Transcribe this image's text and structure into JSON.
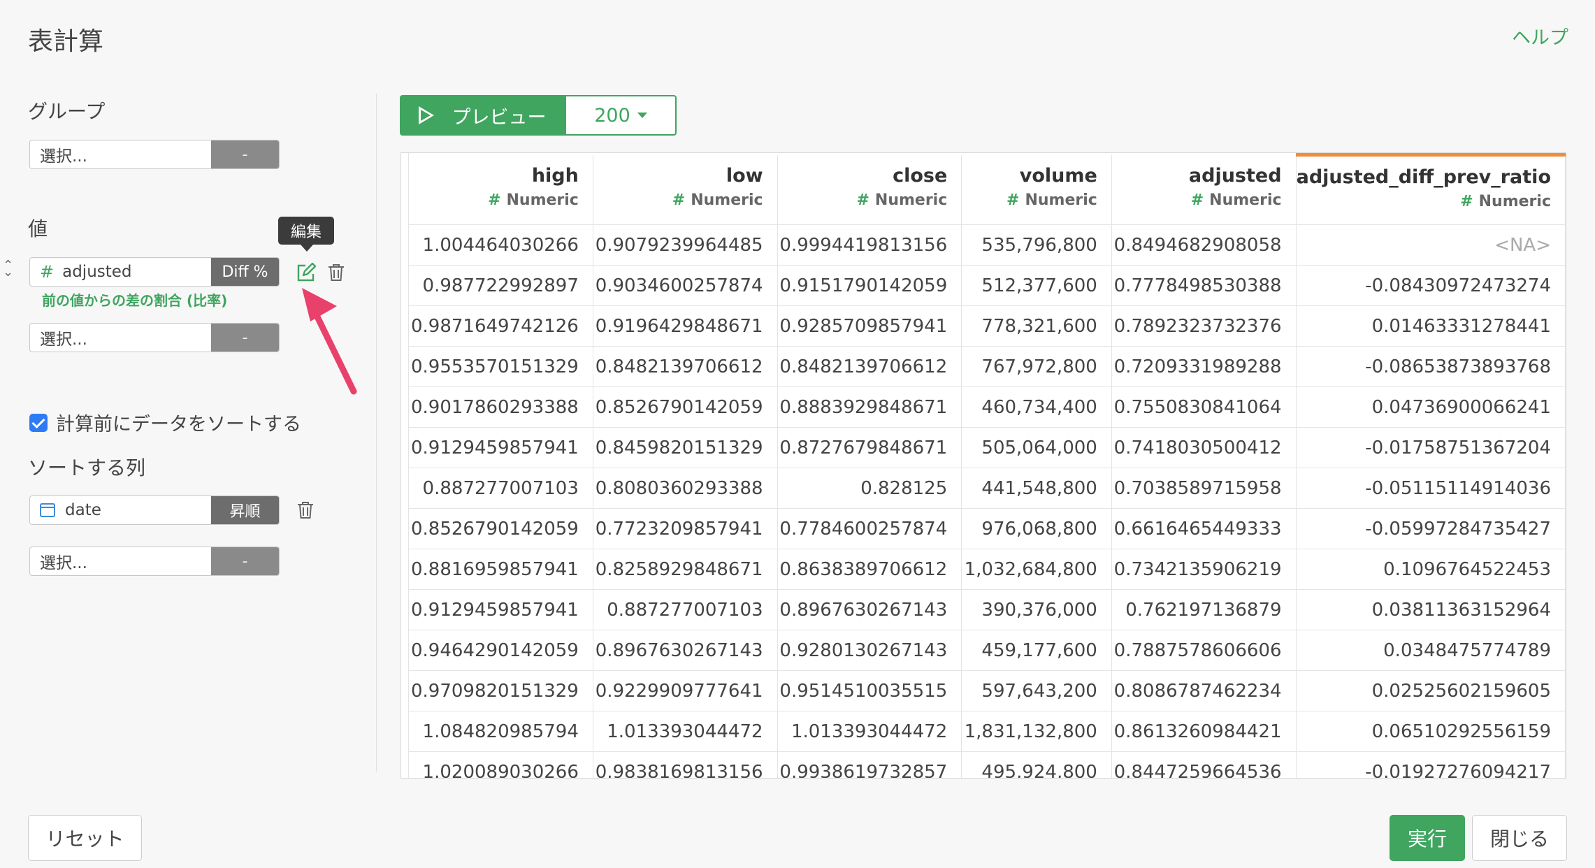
{
  "dialog": {
    "title": "表計算",
    "help": "ヘルプ"
  },
  "group": {
    "label": "グループ",
    "select_placeholder": "選択...",
    "select_btn": "-"
  },
  "values": {
    "label": "値",
    "item": {
      "type_icon": "#",
      "name": "adjusted",
      "calc": "Diff %",
      "description": "前の値からの差の割合 (比率)"
    },
    "edit_tooltip": "編集",
    "select_placeholder": "選択...",
    "select_btn": "-"
  },
  "sort": {
    "checkbox_label": "計算前にデータをソートする",
    "checked": true,
    "columns_label": "ソートする列",
    "item": {
      "name": "date",
      "order": "昇順"
    },
    "select_placeholder": "選択...",
    "select_btn": "-"
  },
  "preview": {
    "label": "プレビュー",
    "count": "200"
  },
  "table": {
    "columns": [
      {
        "name": "high",
        "type": "Numeric"
      },
      {
        "name": "low",
        "type": "Numeric"
      },
      {
        "name": "close",
        "type": "Numeric"
      },
      {
        "name": "volume",
        "type": "Numeric"
      },
      {
        "name": "adjusted",
        "type": "Numeric"
      },
      {
        "name": "adjusted_diff_prev_ratio",
        "type": "Numeric"
      }
    ],
    "type_icon": "#",
    "rows": [
      [
        "1.004464030266",
        "0.9079239964485",
        "0.9994419813156",
        "535,796,800",
        "0.8494682908058",
        "<NA>"
      ],
      [
        "0.987722992897",
        "0.9034600257874",
        "0.9151790142059",
        "512,377,600",
        "0.7778498530388",
        "-0.08430972473274"
      ],
      [
        "0.9871649742126",
        "0.9196429848671",
        "0.9285709857941",
        "778,321,600",
        "0.7892323732376",
        "0.01463331278441"
      ],
      [
        "0.9553570151329",
        "0.8482139706612",
        "0.8482139706612",
        "767,972,800",
        "0.7209331989288",
        "-0.08653873893768"
      ],
      [
        "0.9017860293388",
        "0.8526790142059",
        "0.8883929848671",
        "460,734,400",
        "0.7550830841064",
        "0.04736900066241"
      ],
      [
        "0.9129459857941",
        "0.8459820151329",
        "0.8727679848671",
        "505,064,000",
        "0.7418030500412",
        "-0.01758751367204"
      ],
      [
        "0.887277007103",
        "0.8080360293388",
        "0.828125",
        "441,548,800",
        "0.7038589715958",
        "-0.05115114914036"
      ],
      [
        "0.8526790142059",
        "0.7723209857941",
        "0.7784600257874",
        "976,068,800",
        "0.6616465449333",
        "-0.05997284735427"
      ],
      [
        "0.8816959857941",
        "0.8258929848671",
        "0.8638389706612",
        "1,032,684,800",
        "0.7342135906219",
        "0.1096764522453"
      ],
      [
        "0.9129459857941",
        "0.887277007103",
        "0.8967630267143",
        "390,376,000",
        "0.762197136879",
        "0.03811363152964"
      ],
      [
        "0.9464290142059",
        "0.8967630267143",
        "0.9280130267143",
        "459,177,600",
        "0.7887578606606",
        "0.0348475774789"
      ],
      [
        "0.9709820151329",
        "0.9229909777641",
        "0.9514510035515",
        "597,643,200",
        "0.8086787462234",
        "0.02525602159605"
      ],
      [
        "1.084820985794",
        "1.013393044472",
        "1.013393044472",
        "1,831,132,800",
        "0.8613260984421",
        "0.06510292556159"
      ],
      [
        "1.020089030266",
        "0.9838169813156",
        "0.9938619732857",
        "495,924,800",
        "0.8447259664536",
        "-0.01927276094217"
      ]
    ]
  },
  "footer": {
    "reset": "リセット",
    "run": "実行",
    "close": "閉じる"
  },
  "colors": {
    "accent": "#3fa55f",
    "highlight_column": "#f08c3a",
    "arrow": "#e8416b"
  }
}
